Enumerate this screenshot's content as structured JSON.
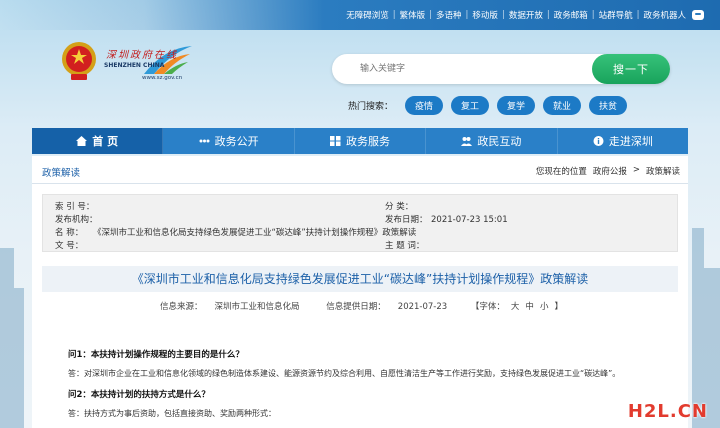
{
  "top_links": [
    "无障碍浏览",
    "繁体版",
    "多语种",
    "移动版",
    "数据开放",
    "政务邮箱",
    "站群导航",
    "政务机器人"
  ],
  "logo": {
    "title_cn": "深圳政府在线",
    "title_en": "SHENZHEN CHINA",
    "url": "www.sz.gov.cn"
  },
  "search": {
    "placeholder": "输入关键字",
    "button_label": "搜一下"
  },
  "hot_search": {
    "label": "热门搜索：",
    "tags": [
      "疫情",
      "复工",
      "复学",
      "就业",
      "扶贫"
    ]
  },
  "nav": [
    {
      "label": "首 页",
      "icon": "home-icon",
      "active": true
    },
    {
      "label": "政务公开",
      "icon": "dots-icon",
      "active": false
    },
    {
      "label": "政务服务",
      "icon": "grid-icon",
      "active": false
    },
    {
      "label": "政民互动",
      "icon": "people-icon",
      "active": false
    },
    {
      "label": "走进深圳",
      "icon": "info-icon",
      "active": false
    }
  ],
  "breadcrumb": {
    "section": "政策解读",
    "location_label": "您现在的位置",
    "items": [
      "政府公报",
      ">",
      "政策解读"
    ]
  },
  "meta": {
    "index_label": "索 引 号：",
    "index_value": "",
    "category_label": "分 类：",
    "category_value": "",
    "issuer_label": "发布机构：",
    "issuer_value": "",
    "date_label": "发布日期：",
    "date_value": "2021-07-23 15:01",
    "name_label": "名 称：",
    "name_value": "《深圳市工业和信息化局支持绿色发展促进工业“碳达峰”扶持计划操作规程》政策解读",
    "docno_label": "文 号：",
    "docno_value": "",
    "keywords_label": "主 题 词：",
    "keywords_value": ""
  },
  "article": {
    "title": "《深圳市工业和信息化局支持绿色发展促进工业“碳达峰”扶持计划操作规程》政策解读",
    "source_label": "信息来源：",
    "source_value": "深圳市工业和信息化局",
    "date_label": "信息提供日期：",
    "date_value": "2021-07-23",
    "font_label": "【字体：",
    "font_sizes": [
      "大",
      "中",
      "小"
    ],
    "font_end": "】",
    "qa": [
      {
        "q": "问1：本扶持计划操作规程的主要目的是什么？",
        "a": "答：对深圳市企业在工业和信息化领域的绿色制造体系建设、能源资源节约及综合利用、自愿性清洁生产等工作进行奖励，支持绿色发展促进工业“碳达峰”。"
      },
      {
        "q": "问2：本扶持计划的扶持方式是什么？",
        "a": "答：扶持方式为事后资助，包括直接资助、奖励两种形式："
      }
    ]
  },
  "watermark": "H2L.CN",
  "colors": {
    "nav_blue": "#2a80c8",
    "nav_active": "#1561a8",
    "tag_blue": "#1c7ac6",
    "search_green": "#19a35c",
    "title_blue": "#1c60a8"
  }
}
